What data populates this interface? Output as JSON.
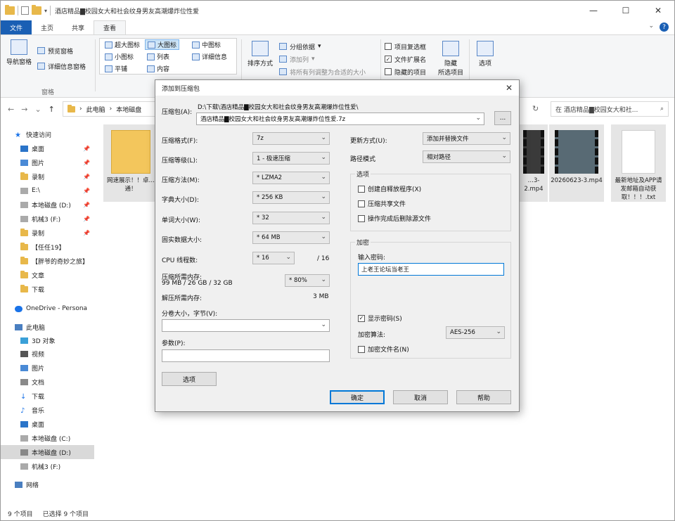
{
  "explorer": {
    "title": "酒店精品▇校园女大和社会纹身男友高潮爆炸位性爱",
    "tabs": [
      "文件",
      "主页",
      "共享",
      "查看"
    ],
    "ribbon": {
      "panes": {
        "nav_pane": "导航窗格",
        "preview": "预览窗格",
        "details": "详细信息窗格",
        "group": "窗格"
      },
      "layout": {
        "xl": "超大图标",
        "large": "大图标",
        "medium": "中图标",
        "small": "小图标",
        "list": "列表",
        "details": "详细信息",
        "tiles": "平铺",
        "content": "内容"
      },
      "view": {
        "sort": "排序方式",
        "group_by": "分组依据",
        "add_col": "添加列",
        "fit_cols": "将所有列调整为合适的大小"
      },
      "show": {
        "item_checkbox": "项目复选框",
        "extensions": "文件扩展名",
        "hidden_items": "隐藏的项目",
        "hide": "隐藏",
        "selected": "所选项目"
      },
      "options": "选项"
    },
    "address": {
      "breadcrumb": [
        "此电脑",
        "本地磁盘"
      ]
    },
    "search": {
      "placeholder": "在 酒店精品▇校园女大和社..."
    },
    "sidebar": [
      "快速访问",
      "桌面",
      "图片",
      "录制",
      "E:\\",
      "本地磁盘 (D:)",
      "机械3 (F:)",
      "录制",
      "【任任19】",
      "【胖爷的奇妙之旅】",
      "文章",
      "下载",
      "OneDrive - Persona",
      "此电脑",
      "3D 对象",
      "视频",
      "图片",
      "文档",
      "下载",
      "音乐",
      "桌面",
      "本地磁盘 (C:)",
      "本地磁盘 (D:)",
      "机械3 (F:)",
      "网络"
    ],
    "files": [
      {
        "label": "网速展示！！卓…通！"
      },
      {
        "label": "…3-2.mp4"
      },
      {
        "label": "20260623-3.mp4"
      },
      {
        "label": "最新地址及APP请发邮箱自动获取！！！.txt"
      }
    ],
    "status": {
      "count": "9 个项目",
      "selected": "已选择 9 个项目"
    }
  },
  "dialog": {
    "title": "添加到压缩包",
    "archive_label": "压缩包(A):",
    "archive_path": "D:\\下载\\酒店精品▇校园女大和社会纹身男友高潮爆炸位性爱\\",
    "archive_name": "酒店精品▇校园女大和社会纹身男友高潮爆炸位性爱.7z",
    "browse": "...",
    "format": {
      "label": "压缩格式(F):",
      "value": "7z"
    },
    "level": {
      "label": "压缩等级(L):",
      "value": "1 - 极速压缩"
    },
    "method": {
      "label": "压缩方法(M):",
      "value": "* LZMA2"
    },
    "dict": {
      "label": "字典大小(D):",
      "value": "* 256 KB"
    },
    "word": {
      "label": "单词大小(W):",
      "value": "* 32"
    },
    "solid": {
      "label": "固实数据大小:",
      "value": "* 64 MB"
    },
    "threads": {
      "label": "CPU 线程数:",
      "value": "* 16",
      "max": "/ 16"
    },
    "mem_compress": {
      "label": "压缩所需内存:",
      "value": "99 MB / 26 GB / 32 GB",
      "pct": "* 80%"
    },
    "mem_decompress": {
      "label": "解压所需内存:",
      "value": "3 MB"
    },
    "split": {
      "label": "分卷大小，字节(V):",
      "value": ""
    },
    "params": {
      "label": "参数(P):",
      "value": ""
    },
    "options_btn": "选项",
    "update": {
      "label": "更新方式(U):",
      "value": "添加并替换文件"
    },
    "path_mode": {
      "label": "路径模式",
      "value": "相对路径"
    },
    "options_group": {
      "title": "选项",
      "sfx": "创建自释放程序(X)",
      "shared": "压缩共享文件",
      "delete": "操作完成后删除源文件"
    },
    "encryption": {
      "title": "加密",
      "pwd_label": "输入密码:",
      "password": "上老王论坛当老王",
      "show_pwd": "显示密码(S)",
      "method_label": "加密算法:",
      "method": "AES-256",
      "encrypt_names": "加密文件名(N)"
    },
    "buttons": {
      "ok": "确定",
      "cancel": "取消",
      "help": "帮助"
    }
  }
}
